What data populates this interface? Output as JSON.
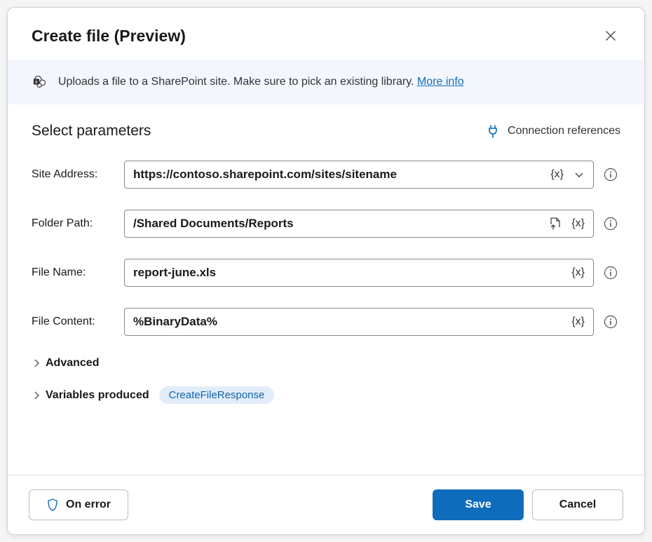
{
  "header": {
    "title": "Create file (Preview)"
  },
  "info_bar": {
    "description": "Uploads a file to a SharePoint site. Make sure to pick an existing library.",
    "more_info_label": "More info"
  },
  "section": {
    "title": "Select parameters",
    "connection_references_label": "Connection references"
  },
  "fields": {
    "site_address": {
      "label": "Site Address:",
      "value": "https://contoso.sharepoint.com/sites/sitename",
      "var_token": "{x}"
    },
    "folder_path": {
      "label": "Folder Path:",
      "value": "/Shared Documents/Reports",
      "var_token": "{x}"
    },
    "file_name": {
      "label": "File Name:",
      "value": "report-june.xls",
      "var_token": "{x}"
    },
    "file_content": {
      "label": "File Content:",
      "value": "%BinaryData%",
      "var_token": "{x}"
    }
  },
  "advanced_label": "Advanced",
  "variables_produced_label": "Variables produced",
  "variable_chip": "CreateFileResponse",
  "footer": {
    "on_error": "On error",
    "save": "Save",
    "cancel": "Cancel"
  }
}
